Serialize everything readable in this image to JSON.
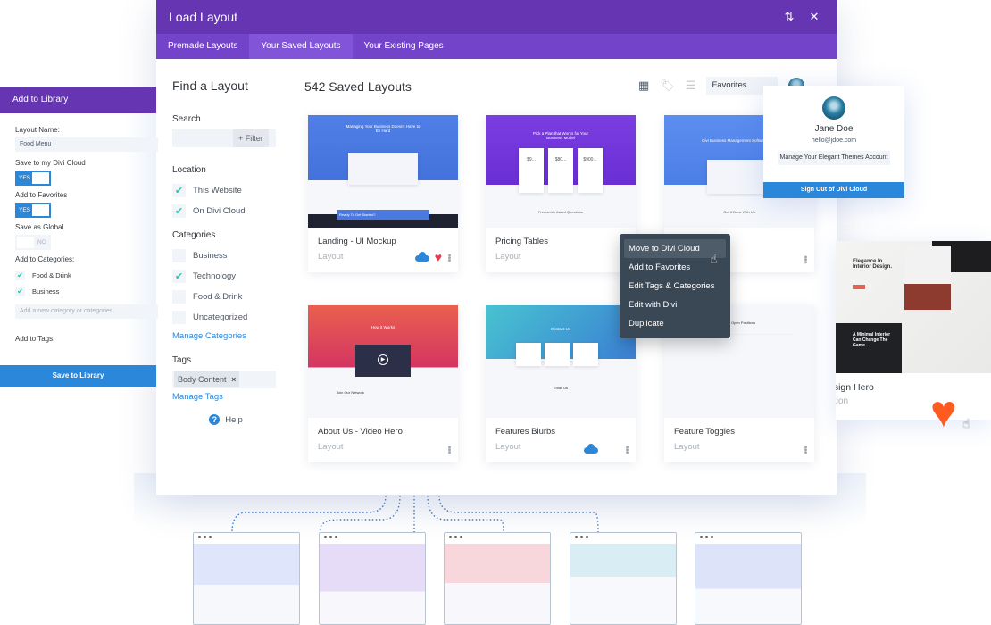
{
  "modal": {
    "title": "Load Layout",
    "tabs": [
      {
        "label": "Premade Layouts",
        "active": false
      },
      {
        "label": "Your Saved Layouts",
        "active": true
      },
      {
        "label": "Your Existing Pages",
        "active": false
      }
    ],
    "header_icons": [
      "sort-icon",
      "close-icon"
    ]
  },
  "sidebar": {
    "title": "Find a Layout",
    "search_label": "Search",
    "search_placeholder": "",
    "filter_label": "+ Filter",
    "location_label": "Location",
    "locations": [
      {
        "label": "This Website",
        "checked": true
      },
      {
        "label": "On Divi Cloud",
        "checked": true
      }
    ],
    "categories_label": "Categories",
    "categories": [
      {
        "label": "Business",
        "checked": false
      },
      {
        "label": "Technology",
        "checked": true
      },
      {
        "label": "Food & Drink",
        "checked": false
      },
      {
        "label": "Uncategorized",
        "checked": false
      }
    ],
    "manage_categories": "Manage Categories",
    "tags_label": "Tags",
    "tags": [
      {
        "label": "Body Content",
        "remove": "×"
      }
    ],
    "manage_tags": "Manage Tags",
    "help": "Help"
  },
  "main": {
    "title": "542 Saved Layouts",
    "view_icons": [
      "grid-icon",
      "tag-icon",
      "list-icon"
    ],
    "filter_select": "Favorites",
    "cards": [
      {
        "name": "Landing - UI Mockup",
        "type": "Layout",
        "cloud": true,
        "favorite": true,
        "preview_heading": "Managing Your Business Doesn't Have to Be Hard",
        "preview_cta": "Ready To Get Started?"
      },
      {
        "name": "Pricing Tables",
        "type": "Layout",
        "cloud": false,
        "favorite": true,
        "preview_heading": "Pick a Plan that Works for Your Business Model",
        "prices": [
          "$9...",
          "$80...",
          "$900..."
        ],
        "preview_sub": "Frequently Asked Questions"
      },
      {
        "name": "",
        "type": "",
        "cloud": false,
        "favorite": false,
        "preview_heading": "Divi Business Management Software",
        "preview_sub": "Get It Done With Us"
      },
      {
        "name": "About Us - Video Hero",
        "type": "Layout",
        "cloud": false,
        "favorite": false,
        "preview_heading": "How it Works",
        "preview_sub": "Join Our Network"
      },
      {
        "name": "Features Blurbs",
        "type": "Layout",
        "cloud": true,
        "favorite": false,
        "preview_heading": "Contact Us",
        "preview_sub": "Email Us"
      },
      {
        "name": "Feature Toggles",
        "type": "Layout",
        "cloud": false,
        "favorite": false,
        "preview_heading": "Open Positions"
      }
    ]
  },
  "context_menu": {
    "items": [
      {
        "label": "Move to Divi Cloud",
        "hover": true
      },
      {
        "label": "Add to Favorites",
        "hover": false
      },
      {
        "label": "Edit Tags & Categories",
        "hover": false
      },
      {
        "label": "Edit with Divi",
        "hover": false
      },
      {
        "label": "Duplicate",
        "hover": false
      }
    ]
  },
  "profile": {
    "name": "Jane Doe",
    "email": "hello@jdoe.com",
    "manage_label": "Manage Your Elegant Themes Account",
    "signout_label": "Sign Out of Divi Cloud"
  },
  "library": {
    "title": "Add to Library",
    "layout_name_label": "Layout Name:",
    "layout_name_value": "Food Menu",
    "cloud_label": "Save to my Divi Cloud",
    "cloud_toggle": "YES",
    "favorites_label": "Add to Favorites",
    "favorites_toggle": "YES",
    "global_label": "Save as Global",
    "global_toggle": "NO",
    "categories_label": "Add to Categories:",
    "categories": [
      {
        "label": "Food & Drink",
        "checked": true
      },
      {
        "label": "Business",
        "checked": true
      }
    ],
    "new_category_placeholder": "Add a new category or categories",
    "tags_label": "Add to Tags:",
    "save_label": "Save to Library"
  },
  "hero_card": {
    "name": "Design Hero",
    "name_visible": "esign Hero",
    "type_visible": "ction",
    "preview_heading": "Elegance In Interior Design.",
    "preview_sub": "A Minimal Interior Can Change The Game."
  },
  "colors": {
    "purple_header": "#6535b2",
    "purple_tabs": "#7343c9",
    "blue_accent": "#2b87da",
    "check_green": "#29c4a9",
    "heart_red": "#e63b4e",
    "heart_orange": "#ff5a1f",
    "menu_dark": "#3a4754"
  }
}
